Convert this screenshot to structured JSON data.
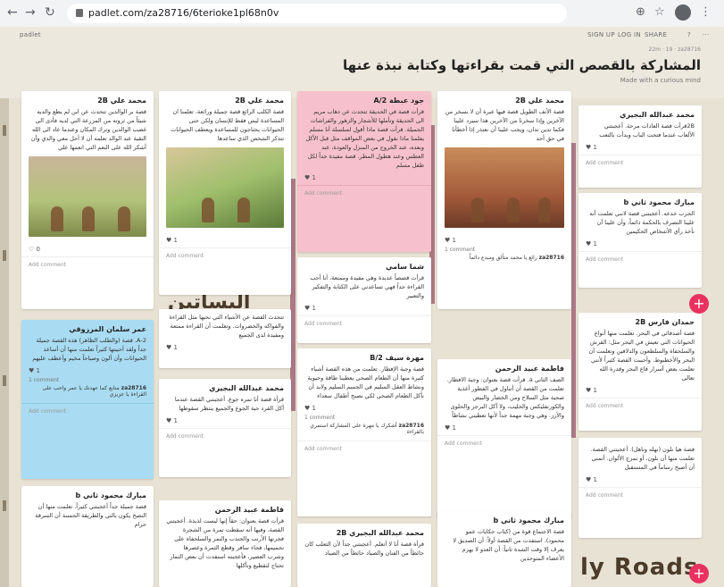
{
  "browser": {
    "back_icon": "arrow-left-icon",
    "url": "padlet.com/za28716/6terioke1pl68n0v"
  },
  "topbar": {
    "brand": "padlet",
    "signup": "SIGN UP",
    "login": "LOG IN",
    "share": "SHARE"
  },
  "header": {
    "meta": "22m · 19 · za28716",
    "title": "المشاركة بالقصص التي قمت بقراءتها وكتابة نبذة عنها",
    "subtitle": "Made with a curious mind"
  },
  "labels": {
    "add_comment": "Add comment",
    "one_comment": "1 comment"
  },
  "col1": {
    "c1": {
      "name": "محمد عبدالله البجيري",
      "body": "2Bقرأت قصة العادات مرحة. أعجبتني الألعاب عندما فتحت الباب وبدأت بالتعب",
      "likes": "1"
    },
    "c2": {
      "name": "مبارك محمود ثاني b",
      "body": "الحرب خدعه. أعجبتني قصة لانني تعلمت أنه علينا التصرف بالحكمة دائماً، وأن علينا أن نأخذ رأي الأشخاص الحكيمين",
      "likes": "1"
    },
    "c3": {
      "name": "حمدان فارس 2B",
      "body": "قصة أصدقائي في البحر. تعلمت منها أنواع الحيوانات التي تعيش في البحر مثل: القرش والسلحفاة والسلطعون والدلافين وتعلمت أن البحر والأخطبوط. وأحببت القصة كثيراً لأنني تعلمت بعض أسرار قاع البحر وقدرة الله تعالى",
      "likes": "1"
    },
    "c4": {
      "name": "",
      "body": "قصة هيا نلون (نهله وناهل). أعجبتني القصة. تعلمت منها أن نلون، أو نمزج الألوان. أتمنى أن أصبح رساماً في المستقبل",
      "likes": "1"
    }
  },
  "col2": {
    "c1": {
      "name": "محمد علي 2B",
      "body": "قصة الأنف الطويل قصة فيها عبرة أن لا نسخر من الآخرين وإذا سخرنا من الآخرين هذا سيرد علينا فكما تدين تدان، ويجب علينا أن نعتذر إذا أخطأنا في حق أحد",
      "likes": "1"
    },
    "c2": {
      "comment_author": "za28716",
      "comment_text": "رائع يا محمد متألق ومبدع دائماً"
    },
    "c3": {
      "name": "فاطمة عبيد الرحمن",
      "body": "الصف الثاني a. قرأت قصة بعنوان: وجبة الافطار. تعلمت من القصة أن أتناول في الفطور أغذية صحية مثل السلاح ومن الخضار والبيض والكورنفليكس والحليب، ولا آكل البرجر والحلوى والأرز. وهي وجبة مهمة جداً لأنها تعطيني نشاطاً",
      "likes": "1"
    },
    "c4": {
      "name": "مبارك محمود ثاني b",
      "body": "قصة الاجتماع قوة من (كتاب حكايات عمو محمود). استفدت من القصة أولاً: أن الصديق لا يعرف إلا وقت الشدة ثانياً: أن العدو لا يهزم الأعضاء المتوحدين",
      "likes": ""
    }
  },
  "col3": {
    "c1": {
      "name": "جود عبطة A/2",
      "body": "قرأت قصة في الحديقة تتحدث عن ذهاب مريم الى الحديقة وتأملها للأشجار والزهور والفراشات الجميلة. قرأت قصة ماذا أقول لسلسلة أنا مسلم يعلمنا ماذا نقول في بعض المواقف مثل قبل الأكل وبعده، عند الخروج من المنزل والعودة، عند العطس وعند هطول المطر. قصة مفيدة جداً لكل طفل مسلم",
      "likes": "1"
    },
    "c2": {
      "name": "شما سامي",
      "body": "قرأت قصصاً عديدة وهي مفيدة وممتعة، أنا أحب القراءة جداً فهي تساعدني على الكتابة والتفكير والتعبير",
      "likes": "1"
    },
    "c3": {
      "name": "مهرة سيف B/2",
      "body": "قصة وجبة الإفطار. تعلمت من هذه القصة أشياء كثيرة منها أن الطعام الصحي يعطينا طاقة وحيوية ونشاط العقل السليم في الجسم السليم ولابد أن نأكل الطعام الصحي لكي نصبح أطفال سعداء",
      "likes": "1",
      "comment_author": "za28716",
      "comment_text": "أشكرك يا مهرة على المشاركة استمري بالقراءة"
    },
    "c4": {
      "name": "محمد عبدالله البجيري 2B",
      "body": "قرأة قصة أنا لا أتعلم. أعجبتني جداً لأن التعلب كان حائطاً من الفنان والصياد حائطاً من الصياد",
      "likes": ""
    }
  },
  "col4": {
    "c1": {
      "name": "محمد علي 2B",
      "body": "قصة الكلب الرائع قصة جميلة ورائعة، تعلمنا ان المساعدة ليس فقط للإنسان ولكن حتى الحيوانات يحتاجون للمساعدة ويعطف الحيوانات تتذكر الشخص الذي ساعدها",
      "likes": "1"
    },
    "c2": {
      "name": "",
      "body": "تتحدث القصة عن الأشياء التي نحبها مثل القراءة والفواكه والخضروات. وتعلمت أن القراءة ممتعة ومفيدة لدى الجميع",
      "likes": "1"
    },
    "c3": {
      "name": "محمد عبدالله البجيري",
      "body": "قرأة قصة أنا تمره جوع. أعجبتني القصة عندما أكل القرد حبة الجوع والجميع ينتظر سقوطها",
      "likes": "1"
    },
    "c4": {
      "name": "فاطمة عبيد الرحمن",
      "body": "قرأت قصة بعنوان: حقاً إنها ليست لذيذة. أعجبتني القصة، وفيها أنه سقطت تمرة من الشجرة فجرتها الأرنب والجندب والنمر والسلحفاة على تحميمها، فجاء سافر وقطع الثمرة وعصرها وشرب العصير، فأعجبته استفدت أن بعض الثمار تحتاج لتقطيع وتأكلها",
      "likes": ""
    }
  },
  "col5": {
    "c1": {
      "name": "محمد علي 2B",
      "body": "قصة بر الوالدين تتحدث عن ابن لم يطع والديه شيئاً من ثروته من المزرعة التي لديه فأدى الى غضب الوالدين وترك المكان وعندما عاد الى الله التقية عند الوالد تعلمه أن لا أحل معي والدي وأن أشكر الله على النعم التي انعمها علي",
      "likes": "0"
    },
    "c2": {
      "name": "عمر سلمان المرزوقي",
      "body": "2-A. قصة (والطلب الظاهر) هذه القصة جميلة جداً ولقد أحببتها كثيراً تعلمت منها أن أساعد الحيوانات وأن ألون وصباحاً مخيم وأعطف عليهم",
      "likes": "1",
      "comment_author": "za28716",
      "comment_text": "متابع كما عهدتك يا عمر واحب على القراءة يا عزيزي"
    },
    "c3": {
      "name": "مبارك محمود ثاني b",
      "body": "قصة جميلة جداً أعجبتني كثيراً. تعلمت منها أن النصح يكون بالتي والطريقة الحسنة أن السرقة حرام",
      "likes": ""
    }
  },
  "decor": {
    "big1": "البساتين",
    "big2": "ly Roads"
  }
}
